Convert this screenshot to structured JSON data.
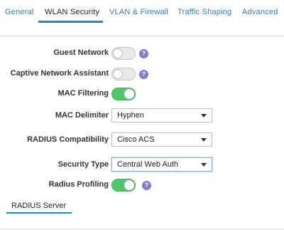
{
  "tabs": [
    {
      "label": "General"
    },
    {
      "label": "WLAN Security"
    },
    {
      "label": "VLAN & Firewall"
    },
    {
      "label": "Traffic Shaping"
    },
    {
      "label": "Advanced"
    }
  ],
  "active_tab": "WLAN Security",
  "help_glyph": "?",
  "fields": {
    "guest_network": {
      "label": "Guest Network",
      "enabled": false
    },
    "captive_network_assistant": {
      "label": "Captive Network Assistant",
      "enabled": false
    },
    "mac_filtering": {
      "label": "MAC Filtering",
      "enabled": true
    },
    "mac_delimiter": {
      "label": "MAC Delimiter",
      "value": "Hyphen"
    },
    "radius_compatibility": {
      "label": "RADIUS Compatibility",
      "value": "Cisco ACS"
    },
    "security_type": {
      "label": "Security Type",
      "value": "Central Web Auth"
    },
    "radius_profiling": {
      "label": "Radius Profiling",
      "enabled": true
    }
  },
  "subtabs": [
    {
      "label": "RADIUS Server"
    }
  ],
  "colors": {
    "accent": "#1f87c6",
    "toggle_on": "#4cc76b",
    "help_icon": "#7c7ce0",
    "tab_link": "#2f7fb8"
  }
}
